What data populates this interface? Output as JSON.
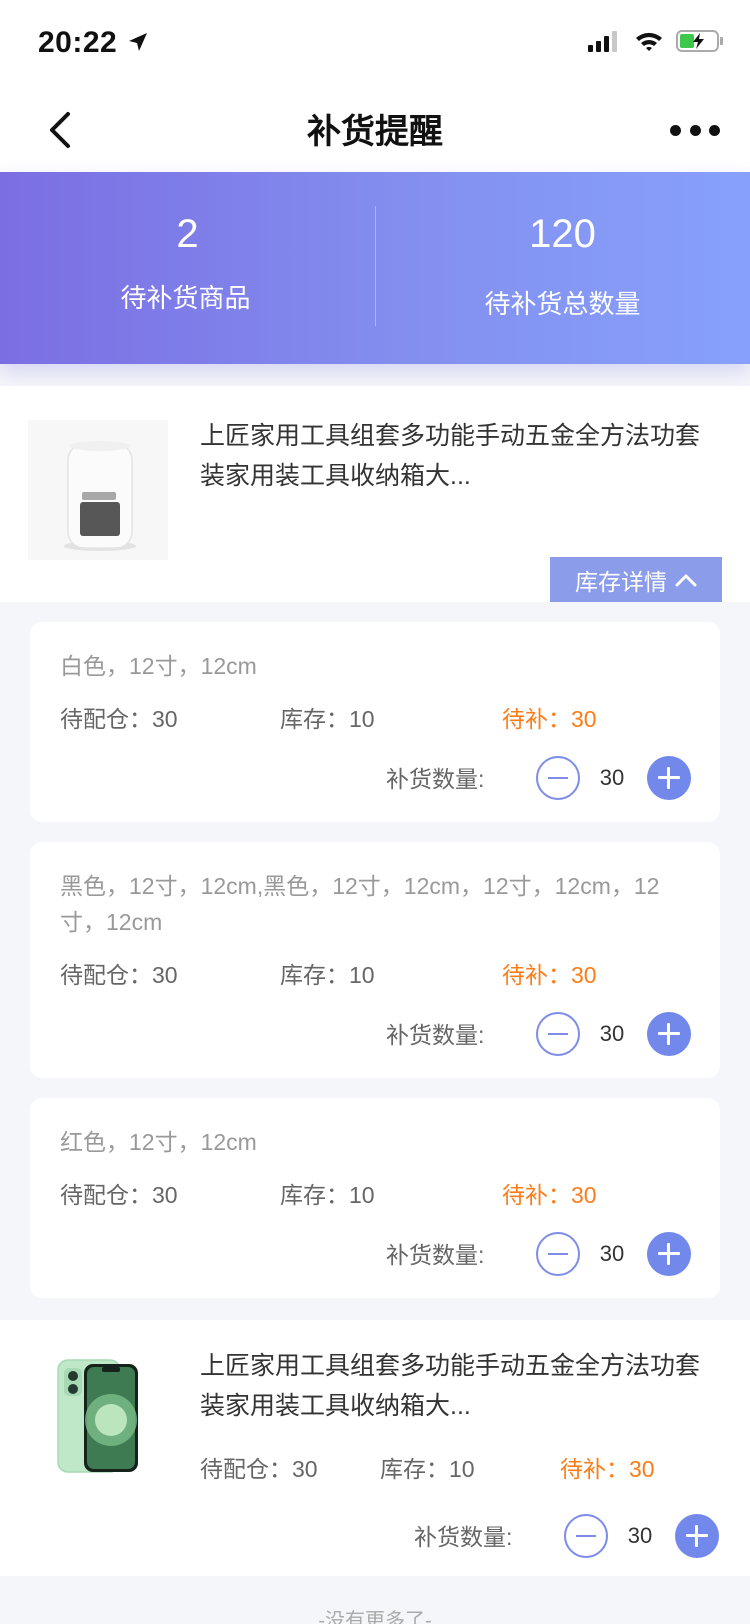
{
  "status_bar": {
    "time": "20:22"
  },
  "nav": {
    "title": "补货提醒"
  },
  "summary": {
    "pending_products_count": "2",
    "pending_products_label": "待补货商品",
    "pending_total_qty": "120",
    "pending_total_label": "待补货总数量"
  },
  "products": [
    {
      "title": "上匠家用工具组套多功能手动五金全方法功套装家用装工具收纳箱大...",
      "stock_detail_label": "库存详情",
      "variants": [
        {
          "spec": "白色，12寸，12cm",
          "warehouse": "待配仓：30",
          "stock": "库存：10",
          "pending": "待补：30",
          "qty_label": "补货数量:",
          "qty": "30"
        },
        {
          "spec": "黑色，12寸，12cm,黑色，12寸，12cm，12寸，12cm，12寸，12cm",
          "warehouse": "待配仓：30",
          "stock": "库存：10",
          "pending": "待补：30",
          "qty_label": "补货数量:",
          "qty": "30"
        },
        {
          "spec": "红色，12寸，12cm",
          "warehouse": "待配仓：30",
          "stock": "库存：10",
          "pending": "待补：30",
          "qty_label": "补货数量:",
          "qty": "30"
        }
      ]
    },
    {
      "title": "上匠家用工具组套多功能手动五金全方法功套装家用装工具收纳箱大...",
      "warehouse": "待配仓：30",
      "stock": "库存：10",
      "pending": "待补：30",
      "qty_label": "补货数量:",
      "qty": "30"
    }
  ],
  "footer": {
    "no_more": "-没有更多了-"
  },
  "colors": {
    "accent": "#7288ea",
    "pending": "#fb7d19",
    "gradient_start": "#7b6ee3",
    "gradient_end": "#87a1fb"
  },
  "icons": [
    "location-arrow-icon",
    "signal-icon",
    "wifi-icon",
    "battery-charging-icon",
    "back-chevron-icon",
    "more-dots-icon",
    "chevron-up-icon",
    "minus-icon",
    "plus-icon"
  ]
}
